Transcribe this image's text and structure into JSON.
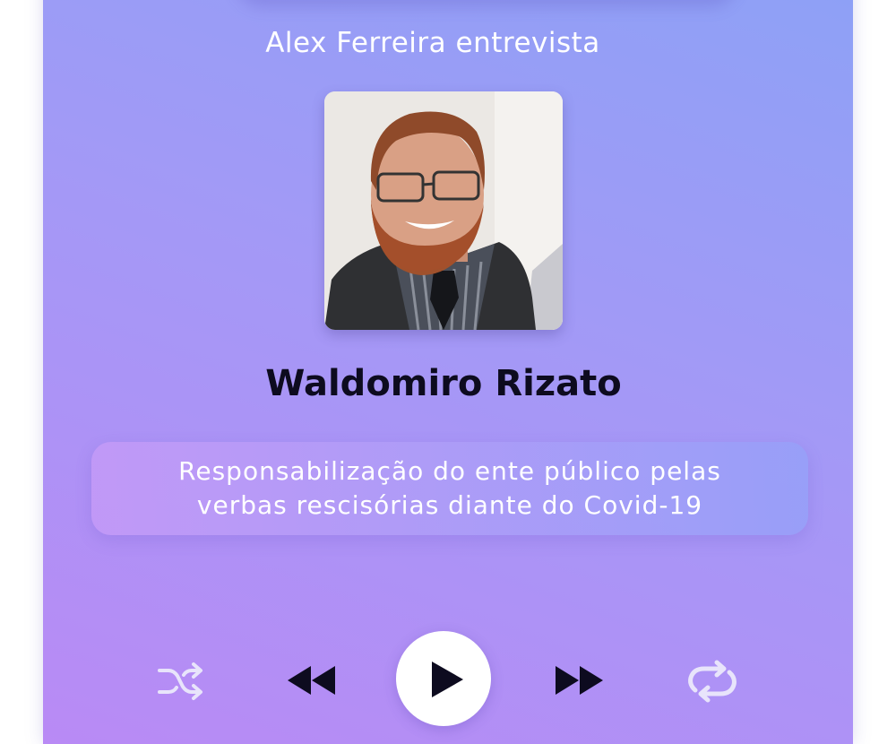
{
  "header": {
    "host_text": "Alex Ferreira entrevista"
  },
  "guest": {
    "name": "Waldomiro Rizato",
    "photo_alt": "Waldomiro Rizato"
  },
  "episode": {
    "topic": "Responsabilização do ente público pelas verbas rescisórias diante do Covid-19"
  },
  "controls": {
    "shuffle_icon": "shuffle-icon",
    "rewind_icon": "rewind-icon",
    "play_icon": "play-icon",
    "forward_icon": "fast-forward-icon",
    "repeat_icon": "repeat-icon"
  },
  "colors": {
    "gradient_start": "#8da1f6",
    "gradient_end": "#b98af5",
    "name_text": "#0d0b1f",
    "icon_light": "#e8e4fb"
  }
}
